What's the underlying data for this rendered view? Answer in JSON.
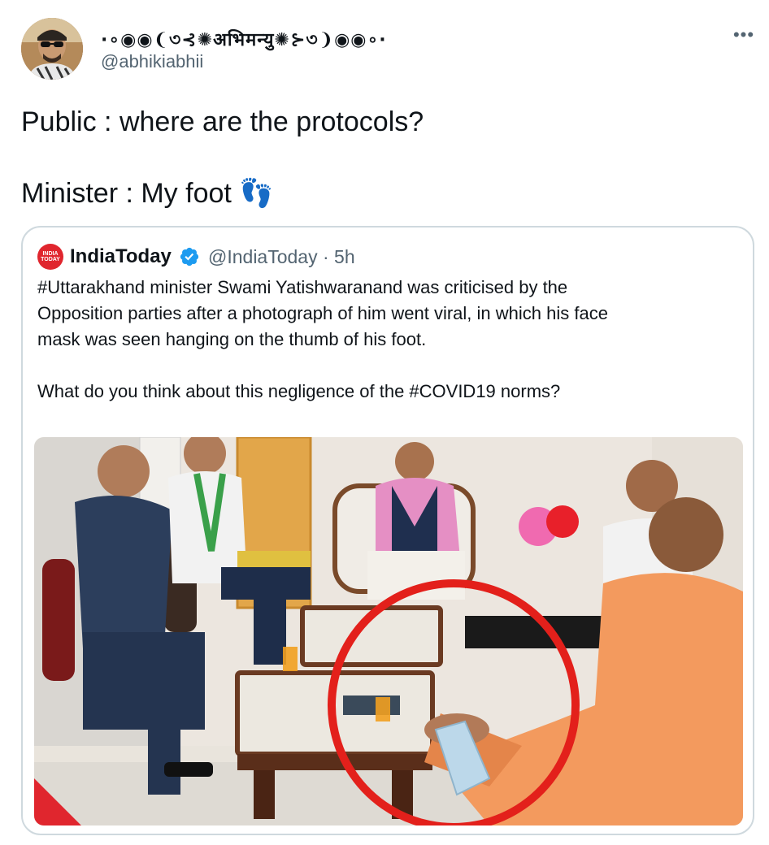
{
  "author": {
    "display_name": "·∘◉◉❨৩⊰✺अभिमन्यु✺⊱৩❩◉◉∘·",
    "handle": "@abhikiabhii",
    "avatar_icon": "user-avatar-photo"
  },
  "actions": {
    "more_label": "•••"
  },
  "tweet": {
    "lines": [
      "Public : where are the protocols?",
      "Minister : My foot 👣"
    ]
  },
  "quote": {
    "logo_lines": [
      "INDIA",
      "TODAY"
    ],
    "name": "IndiaToday",
    "verified_icon": "verified-badge-icon",
    "handle_time": "@IndiaToday · 5h",
    "text_lines": [
      "#Uttarakhand minister Swami Yatishwaranand was criticised by the",
      "Opposition parties after a photograph of him went viral, in which his face",
      "mask was seen hanging on the thumb of his foot.",
      "What do you think about this negligence of the #COVID19 norms?"
    ],
    "photo_icon": "news-photo"
  },
  "colors": {
    "text_primary": "#0f1419",
    "text_secondary": "#536471",
    "border": "#cfd9de",
    "verified": "#1d9bf0",
    "brand_red": "#e0262e",
    "highlight_circle": "#e3201b"
  }
}
